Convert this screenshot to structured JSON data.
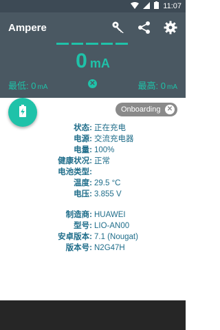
{
  "status_bar": {
    "time": "11:07"
  },
  "app": {
    "title": "Ampere"
  },
  "toolbar": {
    "icons": [
      "key-icon",
      "share-icon",
      "gear-icon"
    ]
  },
  "reading": {
    "value": "0",
    "unit": "mA"
  },
  "min": {
    "label": "最低: 0",
    "unit": "mA"
  },
  "max": {
    "label": "最高: 0",
    "unit": "mA"
  },
  "chip": {
    "label": "Onboarding"
  },
  "battery_info": [
    {
      "key": "状态:",
      "value": "正在充电"
    },
    {
      "key": "电源:",
      "value": "交流充电器"
    },
    {
      "key": "电量:",
      "value": "100%"
    },
    {
      "key": "健康状况:",
      "value": "正常"
    },
    {
      "key": "电池类型:",
      "value": ""
    },
    {
      "key": "温度:",
      "value": "29.5 °C"
    },
    {
      "key": "电压:",
      "value": "3.855 V"
    }
  ],
  "device_info": [
    {
      "key": "制造商:",
      "value": "HUAWEI"
    },
    {
      "key": "型号:",
      "value": "LIO-AN00"
    },
    {
      "key": "安卓版本:",
      "value": "7.1 (Nougat)"
    },
    {
      "key": "版本号:",
      "value": "N2G47H"
    }
  ],
  "colors": {
    "accent": "#1fc2a9",
    "header": "#4a5862",
    "text": "#1f6d8a"
  }
}
